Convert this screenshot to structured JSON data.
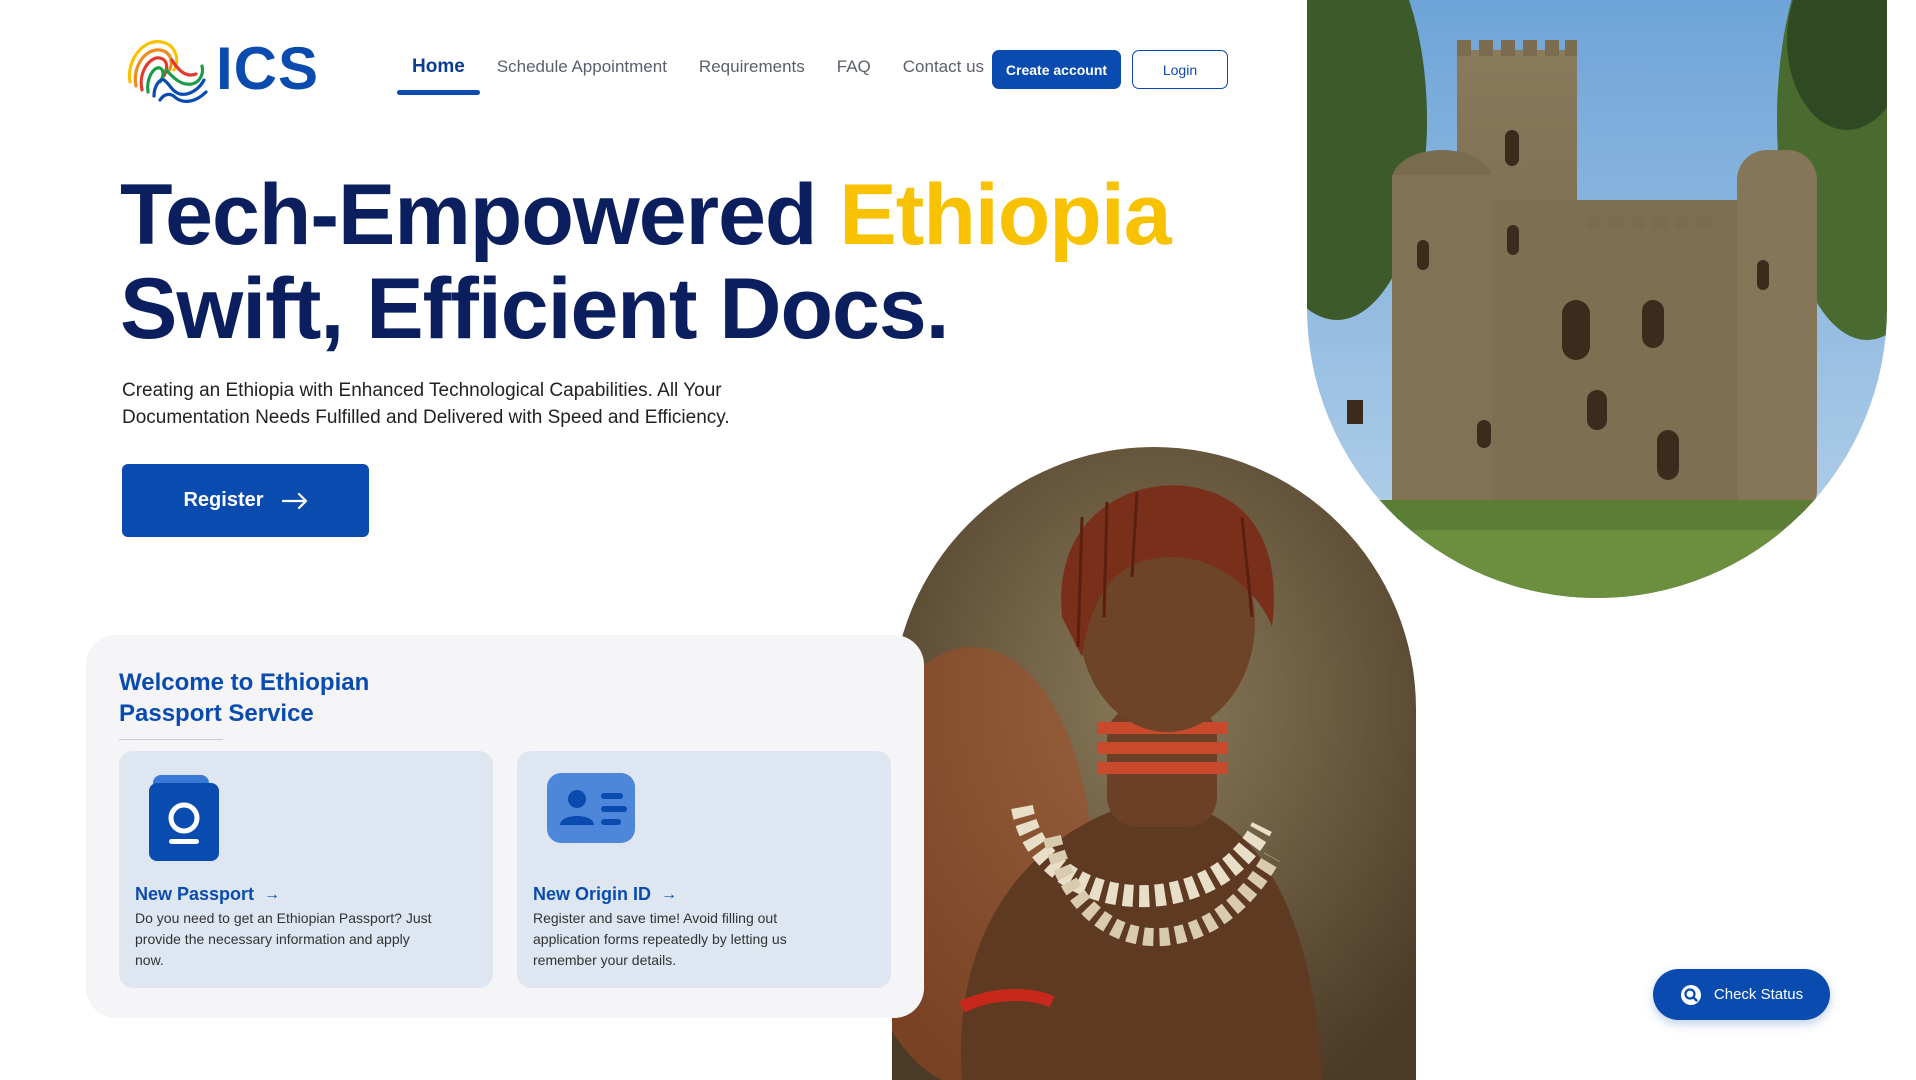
{
  "brand": {
    "logo_text": "ICS",
    "primary_color": "#0a4bb0",
    "accent_color": "#f8c200",
    "title_color": "#0b1f5e"
  },
  "nav": {
    "items": [
      {
        "label": "Home",
        "active": true
      },
      {
        "label": "Schedule Appointment"
      },
      {
        "label": "Requirements"
      },
      {
        "label": "FAQ"
      },
      {
        "label": "Contact us"
      }
    ],
    "create_account": "Create account",
    "login": "Login"
  },
  "hero": {
    "title_part1": "Tech-Empowered ",
    "title_accent": "Ethiopia",
    "title_line2": "Swift, Efficient Docs.",
    "subtitle": "Creating an Ethiopia with Enhanced Technological Capabilities. All Your Documentation Needs Fulfilled and Delivered with Speed and Efficiency.",
    "register_label": "Register",
    "register_icon": "arrow-right-icon"
  },
  "services": {
    "title": "Welcome to Ethiopian Passport Service",
    "cards": [
      {
        "title": "New Passport",
        "icon": "passport-icon",
        "description": "Do you need to get an Ethiopian Passport? Just provide the necessary information and apply now."
      },
      {
        "title": "New Origin ID",
        "icon": "id-card-icon",
        "description": "Register and save time! Avoid filling out application forms repeatedly by letting us remember your details."
      }
    ]
  },
  "check_status": {
    "label": "Check Status",
    "icon": "search-icon"
  },
  "images": {
    "castle": "castle-photo",
    "woman": "portrait-photo"
  }
}
